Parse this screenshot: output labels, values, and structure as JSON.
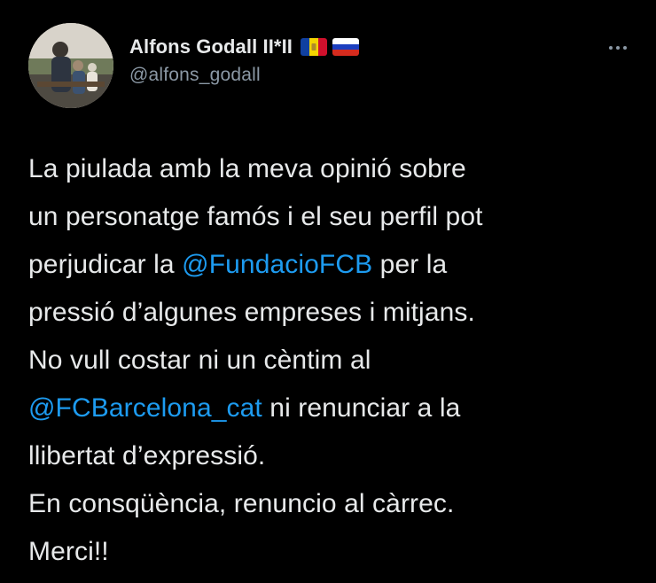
{
  "colors": {
    "background": "#000000",
    "text": "#e7e9ea",
    "secondary_text": "#8b98a5",
    "link": "#1d9bf0"
  },
  "author": {
    "display_name": "Alfons Godall II*II",
    "handle": "@alfons_godall",
    "flags": [
      "andorra-flag-icon",
      "russia-flag-icon"
    ],
    "avatar": "profile-photo"
  },
  "menu": {
    "icon": "more-options-icon"
  },
  "tweet": {
    "segments": [
      {
        "type": "text",
        "text": "La piulada amb la meva opinió sobre\nun personatge famós i el seu perfil pot\nperjudicar la "
      },
      {
        "type": "mention",
        "text": "@FundacioFCB"
      },
      {
        "type": "text",
        "text": " per la\npressió d’algunes empreses i mitjans.\nNo vull costar ni un cèntim al\n"
      },
      {
        "type": "mention",
        "text": "@FCBarcelona_cat"
      },
      {
        "type": "text",
        "text": " ni renunciar a la\nllibertat d’expressió.\nEn consqüència, renuncio al càrrec.\nMerci!!"
      }
    ]
  }
}
